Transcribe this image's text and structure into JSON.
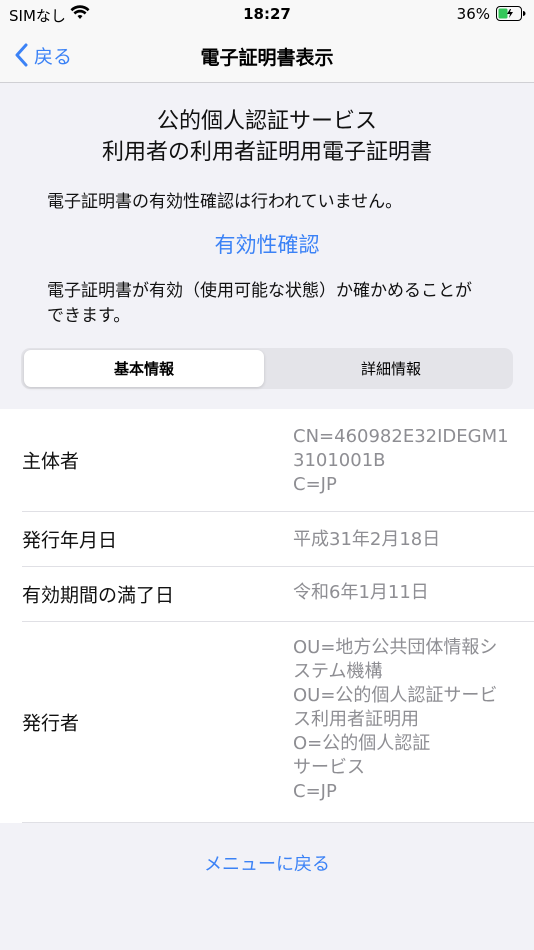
{
  "status_bar": {
    "carrier": "SIMなし",
    "time": "18:27",
    "battery_pct": "36%"
  },
  "nav": {
    "back_label": "戻る",
    "title": "電子証明書表示"
  },
  "header": {
    "title_line1": "公的個人認証サービス",
    "title_line2": "利用者の利用者証明用電子証明書",
    "validity_note": "電子証明書の有効性確認は行われていません。",
    "validity_link": "有効性確認",
    "validity_desc": "電子証明書が有効（使用可能な状態）か確かめることができます。"
  },
  "segmented": {
    "basic": "基本情報",
    "detail": "詳細情報",
    "selected": "基本情報"
  },
  "rows": [
    {
      "label": "主体者",
      "value": "CN=460982E32IDEGM13101001B\nC=JP"
    },
    {
      "label": "発行年月日",
      "value": "平成31年2月18日"
    },
    {
      "label": "有効期間の満了日",
      "value": "令和6年1月11日"
    },
    {
      "label": "発行者",
      "value": "OU=地方公共団体情報システム機構\nOU=公的個人認証サービス利用者証明用\nO=公的個人認証\nサービス\nC=JP"
    }
  ],
  "footer": {
    "menu_link": "メニューに戻る"
  },
  "colors": {
    "accent": "#3b82f6",
    "secondary_text": "#8e8e93",
    "background": "#f2f2f7"
  }
}
